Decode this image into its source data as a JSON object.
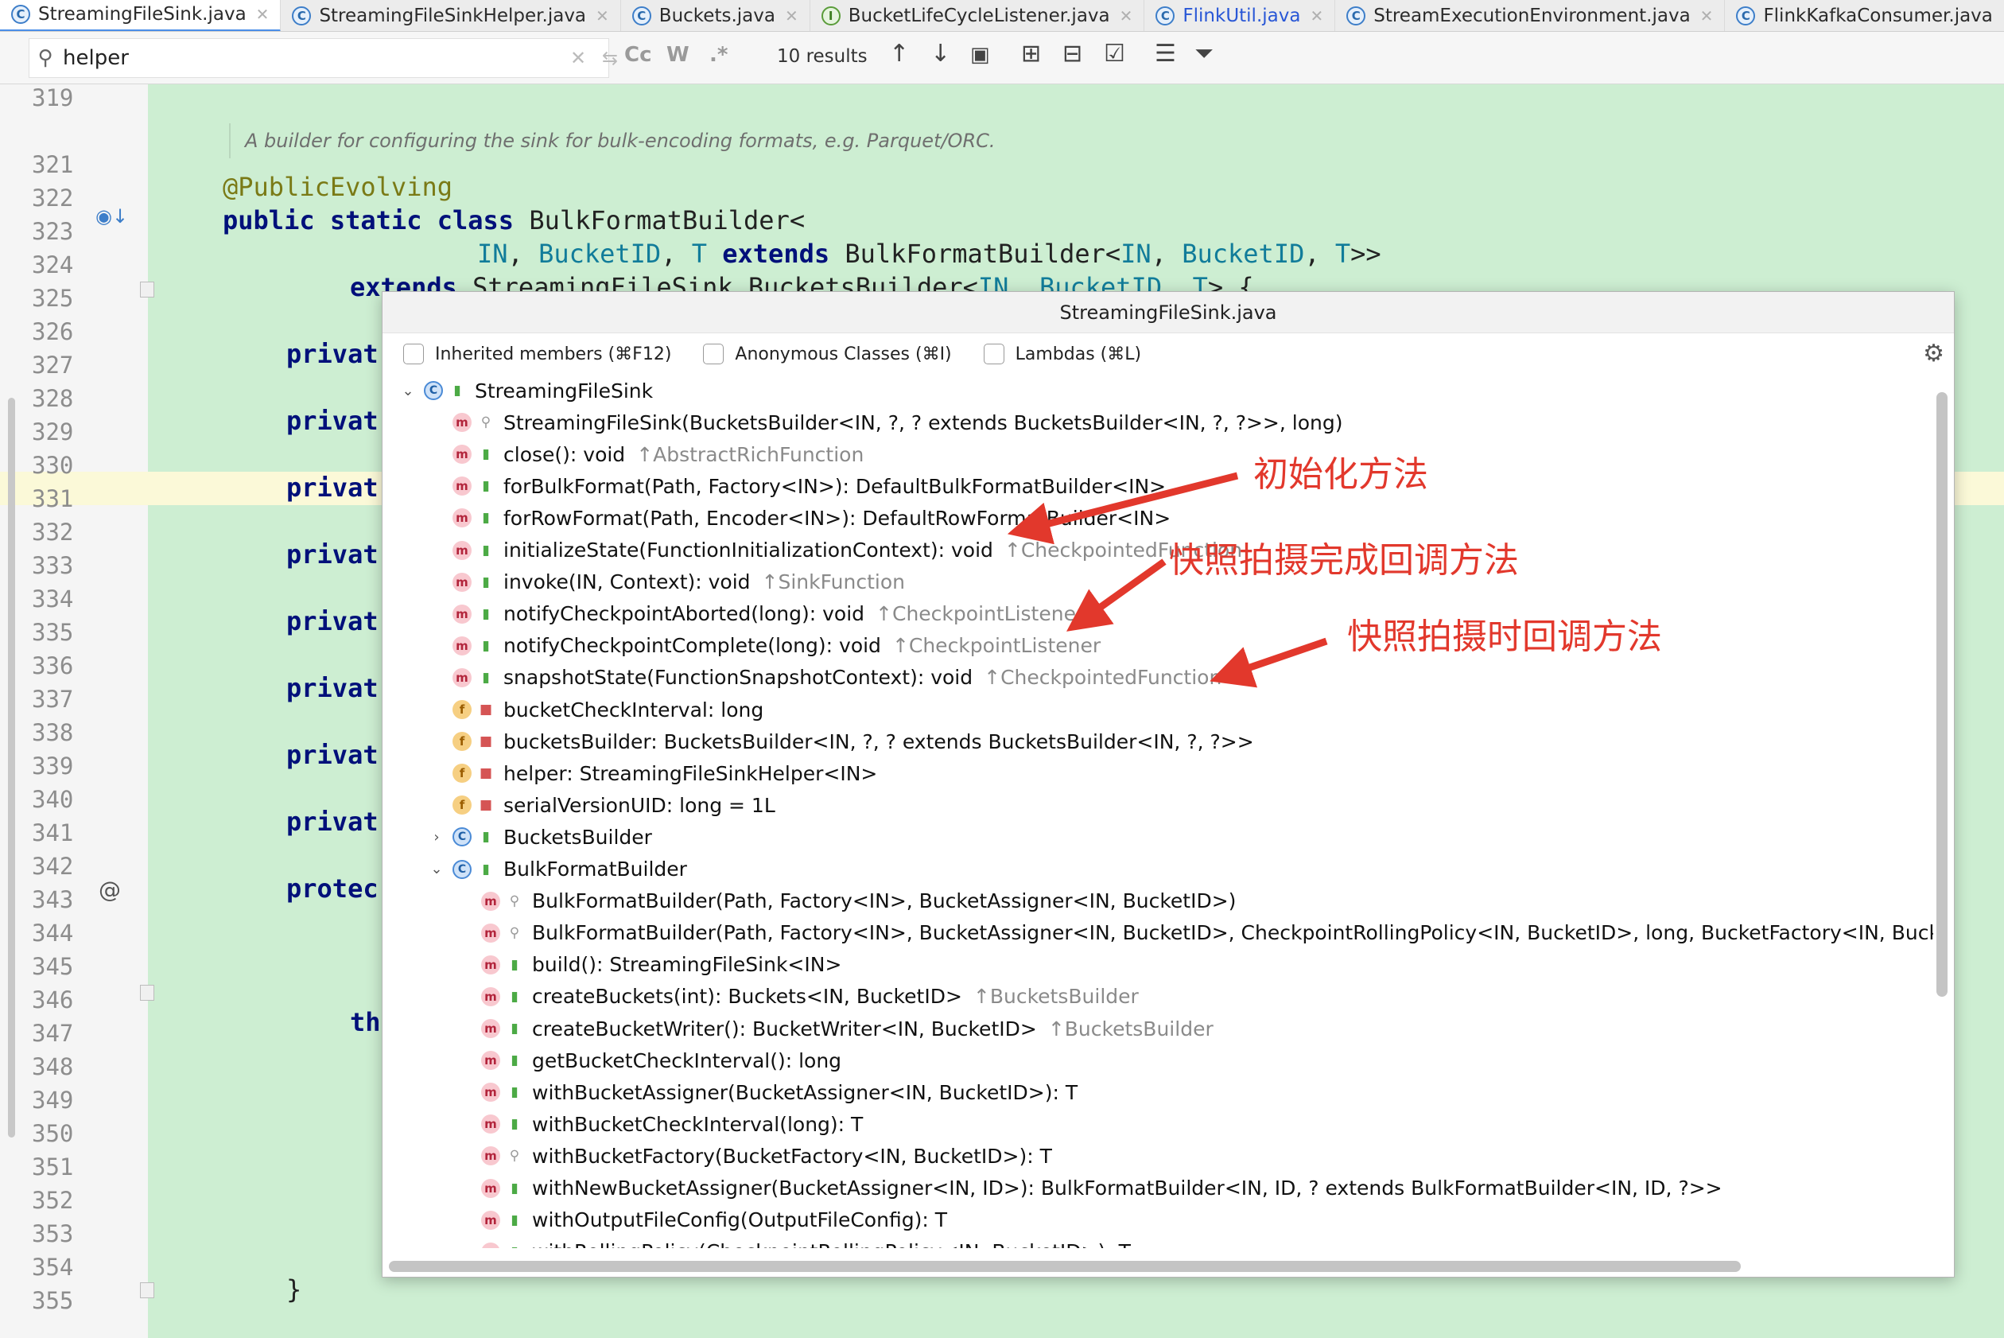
{
  "tabs": [
    {
      "name": "StreamingFileSink.java",
      "kind": "class",
      "active": true
    },
    {
      "name": "StreamingFileSinkHelper.java",
      "kind": "class"
    },
    {
      "name": "Buckets.java",
      "kind": "class"
    },
    {
      "name": "BucketLifeCycleListener.java",
      "kind": "interface"
    },
    {
      "name": "FlinkUtil.java",
      "kind": "class",
      "blue": true
    },
    {
      "name": "StreamExecutionEnvironment.java",
      "kind": "class"
    },
    {
      "name": "FlinkKafkaConsumer.java",
      "kind": "class"
    }
  ],
  "find": {
    "query": "helper",
    "results": "10 results",
    "opts": [
      "Cc",
      "W",
      ".*"
    ]
  },
  "editor": {
    "line_numbers": [
      "319",
      "",
      "321",
      "322",
      "323",
      "324",
      "325",
      "326",
      "327",
      "328",
      "329",
      "330",
      "331",
      "332",
      "333",
      "334",
      "335",
      "336",
      "337",
      "338",
      "339",
      "340",
      "341",
      "342",
      "343",
      "344",
      "345",
      "346",
      "347",
      "348",
      "349",
      "350",
      "351",
      "352",
      "353",
      "354",
      "355"
    ],
    "doc_comment": "A builder for configuring the sink for bulk-encoding formats, e.g. Parquet/ORC.",
    "annotation": "@PublicEvolving",
    "l322": [
      "public",
      "static",
      "class",
      "BulkFormatBuilder<"
    ],
    "l323": [
      "IN",
      "BucketID",
      "T",
      "extends",
      "BulkFormatBuilder<",
      "IN",
      "BucketID",
      "T",
      ">>"
    ],
    "l324": [
      "extends",
      "StreamingFileSink.BucketsBuilder<",
      "IN",
      "BucketID",
      "T",
      "> {"
    ],
    "private_kw": "privat",
    "protected_kw": "protec",
    "this_kw": "th",
    "close_brace": "}"
  },
  "popup": {
    "title": "StreamingFileSink.java",
    "filters": [
      {
        "label": "Inherited members (⌘F12)"
      },
      {
        "label": "Anonymous Classes (⌘I)"
      },
      {
        "label": "Lambdas (⌘L)"
      }
    ],
    "items": [
      {
        "level": 0,
        "type": "c",
        "expand": "open",
        "vis": "pub",
        "text": "StreamingFileSink",
        "inh": ""
      },
      {
        "level": 1,
        "type": "m",
        "vis": "pkg",
        "text": "StreamingFileSink(BucketsBuilder<IN, ?, ? extends BucketsBuilder<IN, ?, ?>>, long)",
        "inh": ""
      },
      {
        "level": 1,
        "type": "m",
        "vis": "pub",
        "text": "close(): void",
        "inh": "↑AbstractRichFunction"
      },
      {
        "level": 1,
        "type": "m",
        "vis": "pub",
        "text": "forBulkFormat(Path, Factory<IN>): DefaultBulkFormatBuilder<IN>",
        "inh": ""
      },
      {
        "level": 1,
        "type": "m",
        "vis": "pub",
        "text": "forRowFormat(Path, Encoder<IN>): DefaultRowFormatBuilder<IN>",
        "inh": ""
      },
      {
        "level": 1,
        "type": "m",
        "vis": "pub",
        "text": "initializeState(FunctionInitializationContext): void",
        "inh": "↑CheckpointedFunction"
      },
      {
        "level": 1,
        "type": "m",
        "vis": "pub",
        "text": "invoke(IN, Context): void",
        "inh": "↑SinkFunction"
      },
      {
        "level": 1,
        "type": "m",
        "vis": "pub",
        "text": "notifyCheckpointAborted(long): void",
        "inh": "↑CheckpointListener"
      },
      {
        "level": 1,
        "type": "m",
        "vis": "pub",
        "text": "notifyCheckpointComplete(long): void",
        "inh": "↑CheckpointListener"
      },
      {
        "level": 1,
        "type": "m",
        "vis": "pub",
        "text": "snapshotState(FunctionSnapshotContext): void",
        "inh": "↑CheckpointedFunction"
      },
      {
        "level": 1,
        "type": "f",
        "vis": "priv",
        "text": "bucketCheckInterval: long",
        "inh": ""
      },
      {
        "level": 1,
        "type": "f",
        "vis": "priv",
        "text": "bucketsBuilder: BucketsBuilder<IN, ?, ? extends BucketsBuilder<IN, ?, ?>>",
        "inh": ""
      },
      {
        "level": 1,
        "type": "f",
        "vis": "priv",
        "text": "helper: StreamingFileSinkHelper<IN>",
        "inh": ""
      },
      {
        "level": 1,
        "type": "f",
        "vis": "priv",
        "text": "serialVersionUID: long = 1L",
        "inh": ""
      },
      {
        "level": 1,
        "type": "c",
        "expand": "closed",
        "vis": "pub",
        "text": "BucketsBuilder",
        "inh": ""
      },
      {
        "level": 1,
        "type": "c",
        "expand": "open",
        "vis": "pub",
        "text": "BulkFormatBuilder",
        "inh": ""
      },
      {
        "level": 2,
        "type": "m",
        "vis": "pkg",
        "text": "BulkFormatBuilder(Path, Factory<IN>, BucketAssigner<IN, BucketID>)",
        "inh": ""
      },
      {
        "level": 2,
        "type": "m",
        "vis": "pkg",
        "text": "BulkFormatBuilder(Path, Factory<IN>, BucketAssigner<IN, BucketID>, CheckpointRollingPolicy<IN, BucketID>, long, BucketFactory<IN, BucketID",
        "inh": ""
      },
      {
        "level": 2,
        "type": "m",
        "vis": "pub",
        "text": "build(): StreamingFileSink<IN>",
        "inh": ""
      },
      {
        "level": 2,
        "type": "m",
        "vis": "pub",
        "text": "createBuckets(int): Buckets<IN, BucketID>",
        "inh": "↑BucketsBuilder"
      },
      {
        "level": 2,
        "type": "m",
        "vis": "pub",
        "text": "createBucketWriter(): BucketWriter<IN, BucketID>",
        "inh": "↑BucketsBuilder"
      },
      {
        "level": 2,
        "type": "m",
        "vis": "pub",
        "text": "getBucketCheckInterval(): long",
        "inh": ""
      },
      {
        "level": 2,
        "type": "m",
        "vis": "pub",
        "text": "withBucketAssigner(BucketAssigner<IN, BucketID>): T",
        "inh": ""
      },
      {
        "level": 2,
        "type": "m",
        "vis": "pub",
        "text": "withBucketCheckInterval(long): T",
        "inh": ""
      },
      {
        "level": 2,
        "type": "m",
        "vis": "pkg",
        "text": "withBucketFactory(BucketFactory<IN, BucketID>): T",
        "inh": ""
      },
      {
        "level": 2,
        "type": "m",
        "vis": "pub",
        "text": "withNewBucketAssigner(BucketAssigner<IN, ID>): BulkFormatBuilder<IN, ID, ? extends BulkFormatBuilder<IN, ID, ?>>",
        "inh": ""
      },
      {
        "level": 2,
        "type": "m",
        "vis": "pub",
        "text": "withOutputFileConfig(OutputFileConfig): T",
        "inh": ""
      },
      {
        "level": 2,
        "type": "m",
        "vis": "pub",
        "text": "withRollingPolicy(CheckpointRollingPolicy<IN, BucketID>): T",
        "inh": ""
      }
    ]
  },
  "annotations": {
    "init": "初始化方法",
    "complete": "快照拍摄完成回调方法",
    "snapshot": "快照拍摄时回调方法"
  },
  "colors": {
    "accent": "#4a8ee8",
    "annotation_red": "#e2382c",
    "code_bg": "#cdeed2"
  }
}
